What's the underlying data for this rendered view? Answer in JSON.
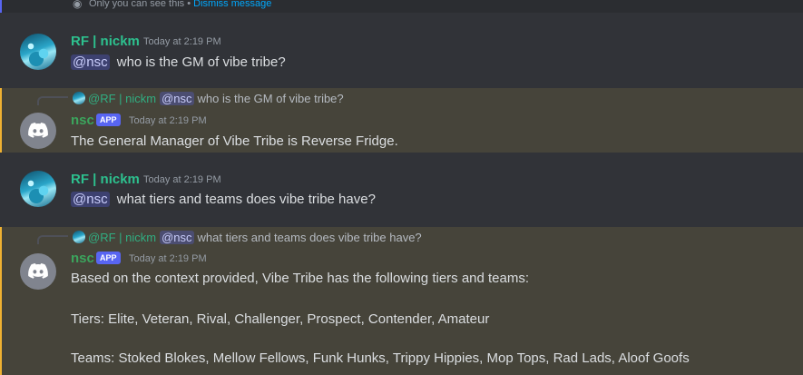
{
  "top_note": {
    "icon": "eye-icon",
    "text": "Only you can see this • ",
    "link": "Dismiss message"
  },
  "messages": [
    {
      "author": "RF | nickm",
      "timestamp": "Today at 2:19 PM",
      "mention": "@nsc",
      "text": "who is the GM of vibe tribe?"
    },
    {
      "author": "nsc",
      "tag": "APP",
      "timestamp": "Today at 2:19 PM",
      "reply": {
        "author": "@RF | nickm",
        "mention": "@nsc",
        "text": "who is the GM of vibe tribe?"
      },
      "text": "The General Manager of Vibe Tribe is Reverse Fridge."
    },
    {
      "author": "RF | nickm",
      "timestamp": "Today at 2:19 PM",
      "mention": "@nsc",
      "text": "what tiers and teams does vibe tribe have?"
    },
    {
      "author": "nsc",
      "tag": "APP",
      "timestamp": "Today at 2:19 PM",
      "reply": {
        "author": "@RF | nickm",
        "mention": "@nsc",
        "text": "what tiers and teams does vibe tribe have?"
      },
      "lines": [
        "Based on the context provided, Vibe Tribe has the following tiers and teams:",
        "Tiers: Elite, Veteran, Rival, Challenger, Prospect, Contender, Amateur",
        "Teams: Stoked Blokes, Mellow Fellows, Funk Hunks, Trippy Hippies, Mop Tops, Rad Lads, Aloof Goofs"
      ]
    }
  ],
  "colors": {
    "background": "#313338",
    "highlight": "#46443a",
    "highlight_bar": "#f0b232",
    "accent": "#5865f2"
  }
}
